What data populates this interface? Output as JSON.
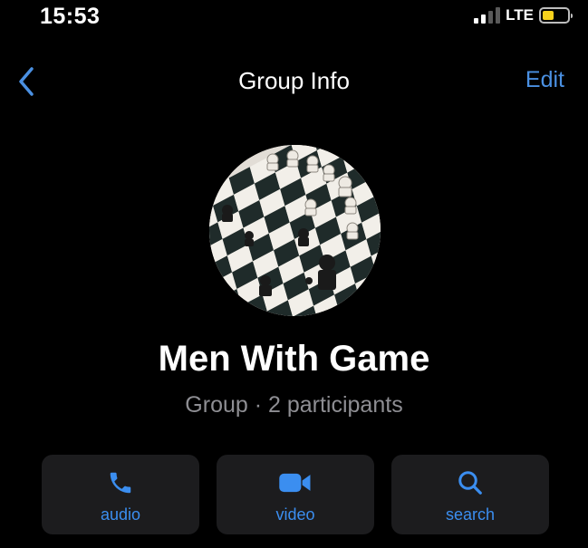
{
  "status_bar": {
    "time": "15:53",
    "network": "LTE",
    "signal_bars_active": 2,
    "signal_bars_total": 4,
    "battery_level": 0.45,
    "battery_color": "#f7d21c"
  },
  "nav": {
    "back_icon": "chevron-left-icon",
    "title": "Group Info",
    "edit_label": "Edit"
  },
  "group": {
    "name": "Men With Game",
    "subtitle": "Group · 2 participants",
    "avatar": "chessboard-photo"
  },
  "actions": [
    {
      "icon": "phone-icon",
      "label": "audio"
    },
    {
      "icon": "video-camera-icon",
      "label": "video"
    },
    {
      "icon": "search-icon",
      "label": "search"
    }
  ],
  "colors": {
    "accent": "#3b8ef0",
    "background": "#000000",
    "card": "#1c1c1e",
    "secondary_text": "#8e8e93"
  }
}
